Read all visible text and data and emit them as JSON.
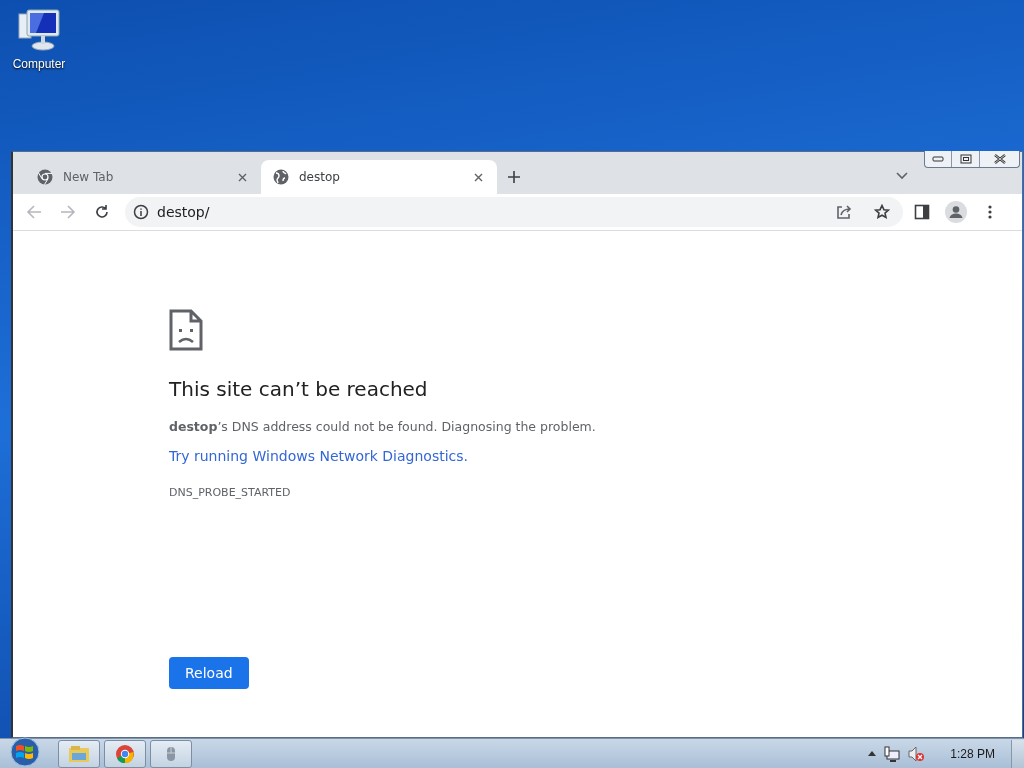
{
  "desktop_icons": [
    {
      "label": "Computer"
    }
  ],
  "browser": {
    "tabs": [
      {
        "title": "New Tab",
        "kind": "newtab",
        "selected": false
      },
      {
        "title": "destop",
        "kind": "site",
        "selected": true
      }
    ],
    "address": "destop/",
    "error": {
      "heading": "This site can’t be reached",
      "message": "**destop**’s DNS address could not be found. Diagnosing the problem.",
      "link": "Try running Windows Network Diagnostics.",
      "code": "DNS_PROBE_STARTED",
      "button": "Reload"
    }
  },
  "taskbar": {
    "apps": [
      {
        "kind": "explorer"
      },
      {
        "kind": "chrome"
      },
      {
        "kind": "mouse"
      }
    ],
    "clock": "1:28 PM"
  }
}
